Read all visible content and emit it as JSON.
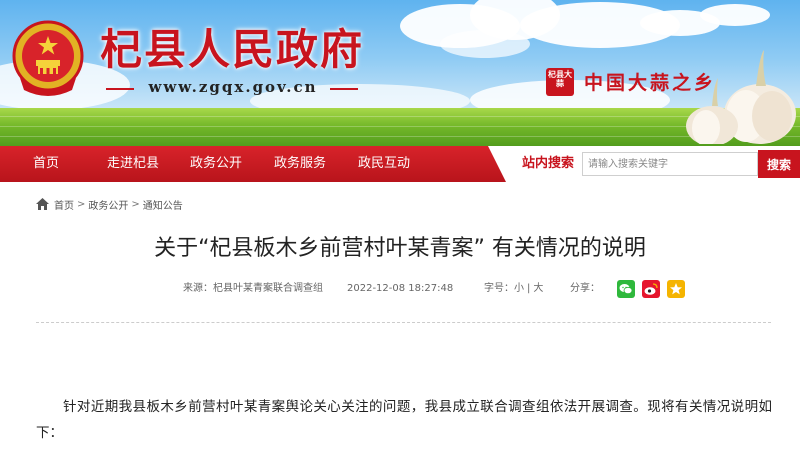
{
  "header": {
    "site_title": "杞县人民政府",
    "site_url": "www.zgqx.gov.cn",
    "seal_text": "杞县大蒜",
    "slogan": "中国大蒜之乡"
  },
  "nav": {
    "items": [
      {
        "label": "首页"
      },
      {
        "label": "走进杞县"
      },
      {
        "label": "政务公开"
      },
      {
        "label": "政务服务"
      },
      {
        "label": "政民互动"
      }
    ],
    "search": {
      "label": "站内搜索",
      "placeholder": "请输入搜索关键字",
      "button": "搜索"
    }
  },
  "breadcrumb": {
    "items": [
      "首页",
      "政务公开",
      "通知公告"
    ],
    "separator": ">"
  },
  "article": {
    "title": "关于“杞县板木乡前营村叶某青案” 有关情况的说明",
    "source": "来源：杞县叶某青案联合调查组",
    "date": "2022-12-08 18:27:48",
    "font_size_label": "字号：",
    "font_small": "小",
    "font_sep": "|",
    "font_large": "大",
    "share_label": "分享：",
    "share_icons": [
      "wechat-icon",
      "weibo-icon",
      "favorite-icon"
    ],
    "paragraph": "针对近期我县板木乡前营村叶某青案舆论关心关注的问题，我县成立联合调查组依法开展调查。现将有关情况说明如下："
  },
  "colors": {
    "brand_red": "#c8141e",
    "nav_red": "#d8232a",
    "wechat_green": "#2fb83c",
    "weibo_red": "#e6162d",
    "favorite_yellow": "#f5b400"
  }
}
